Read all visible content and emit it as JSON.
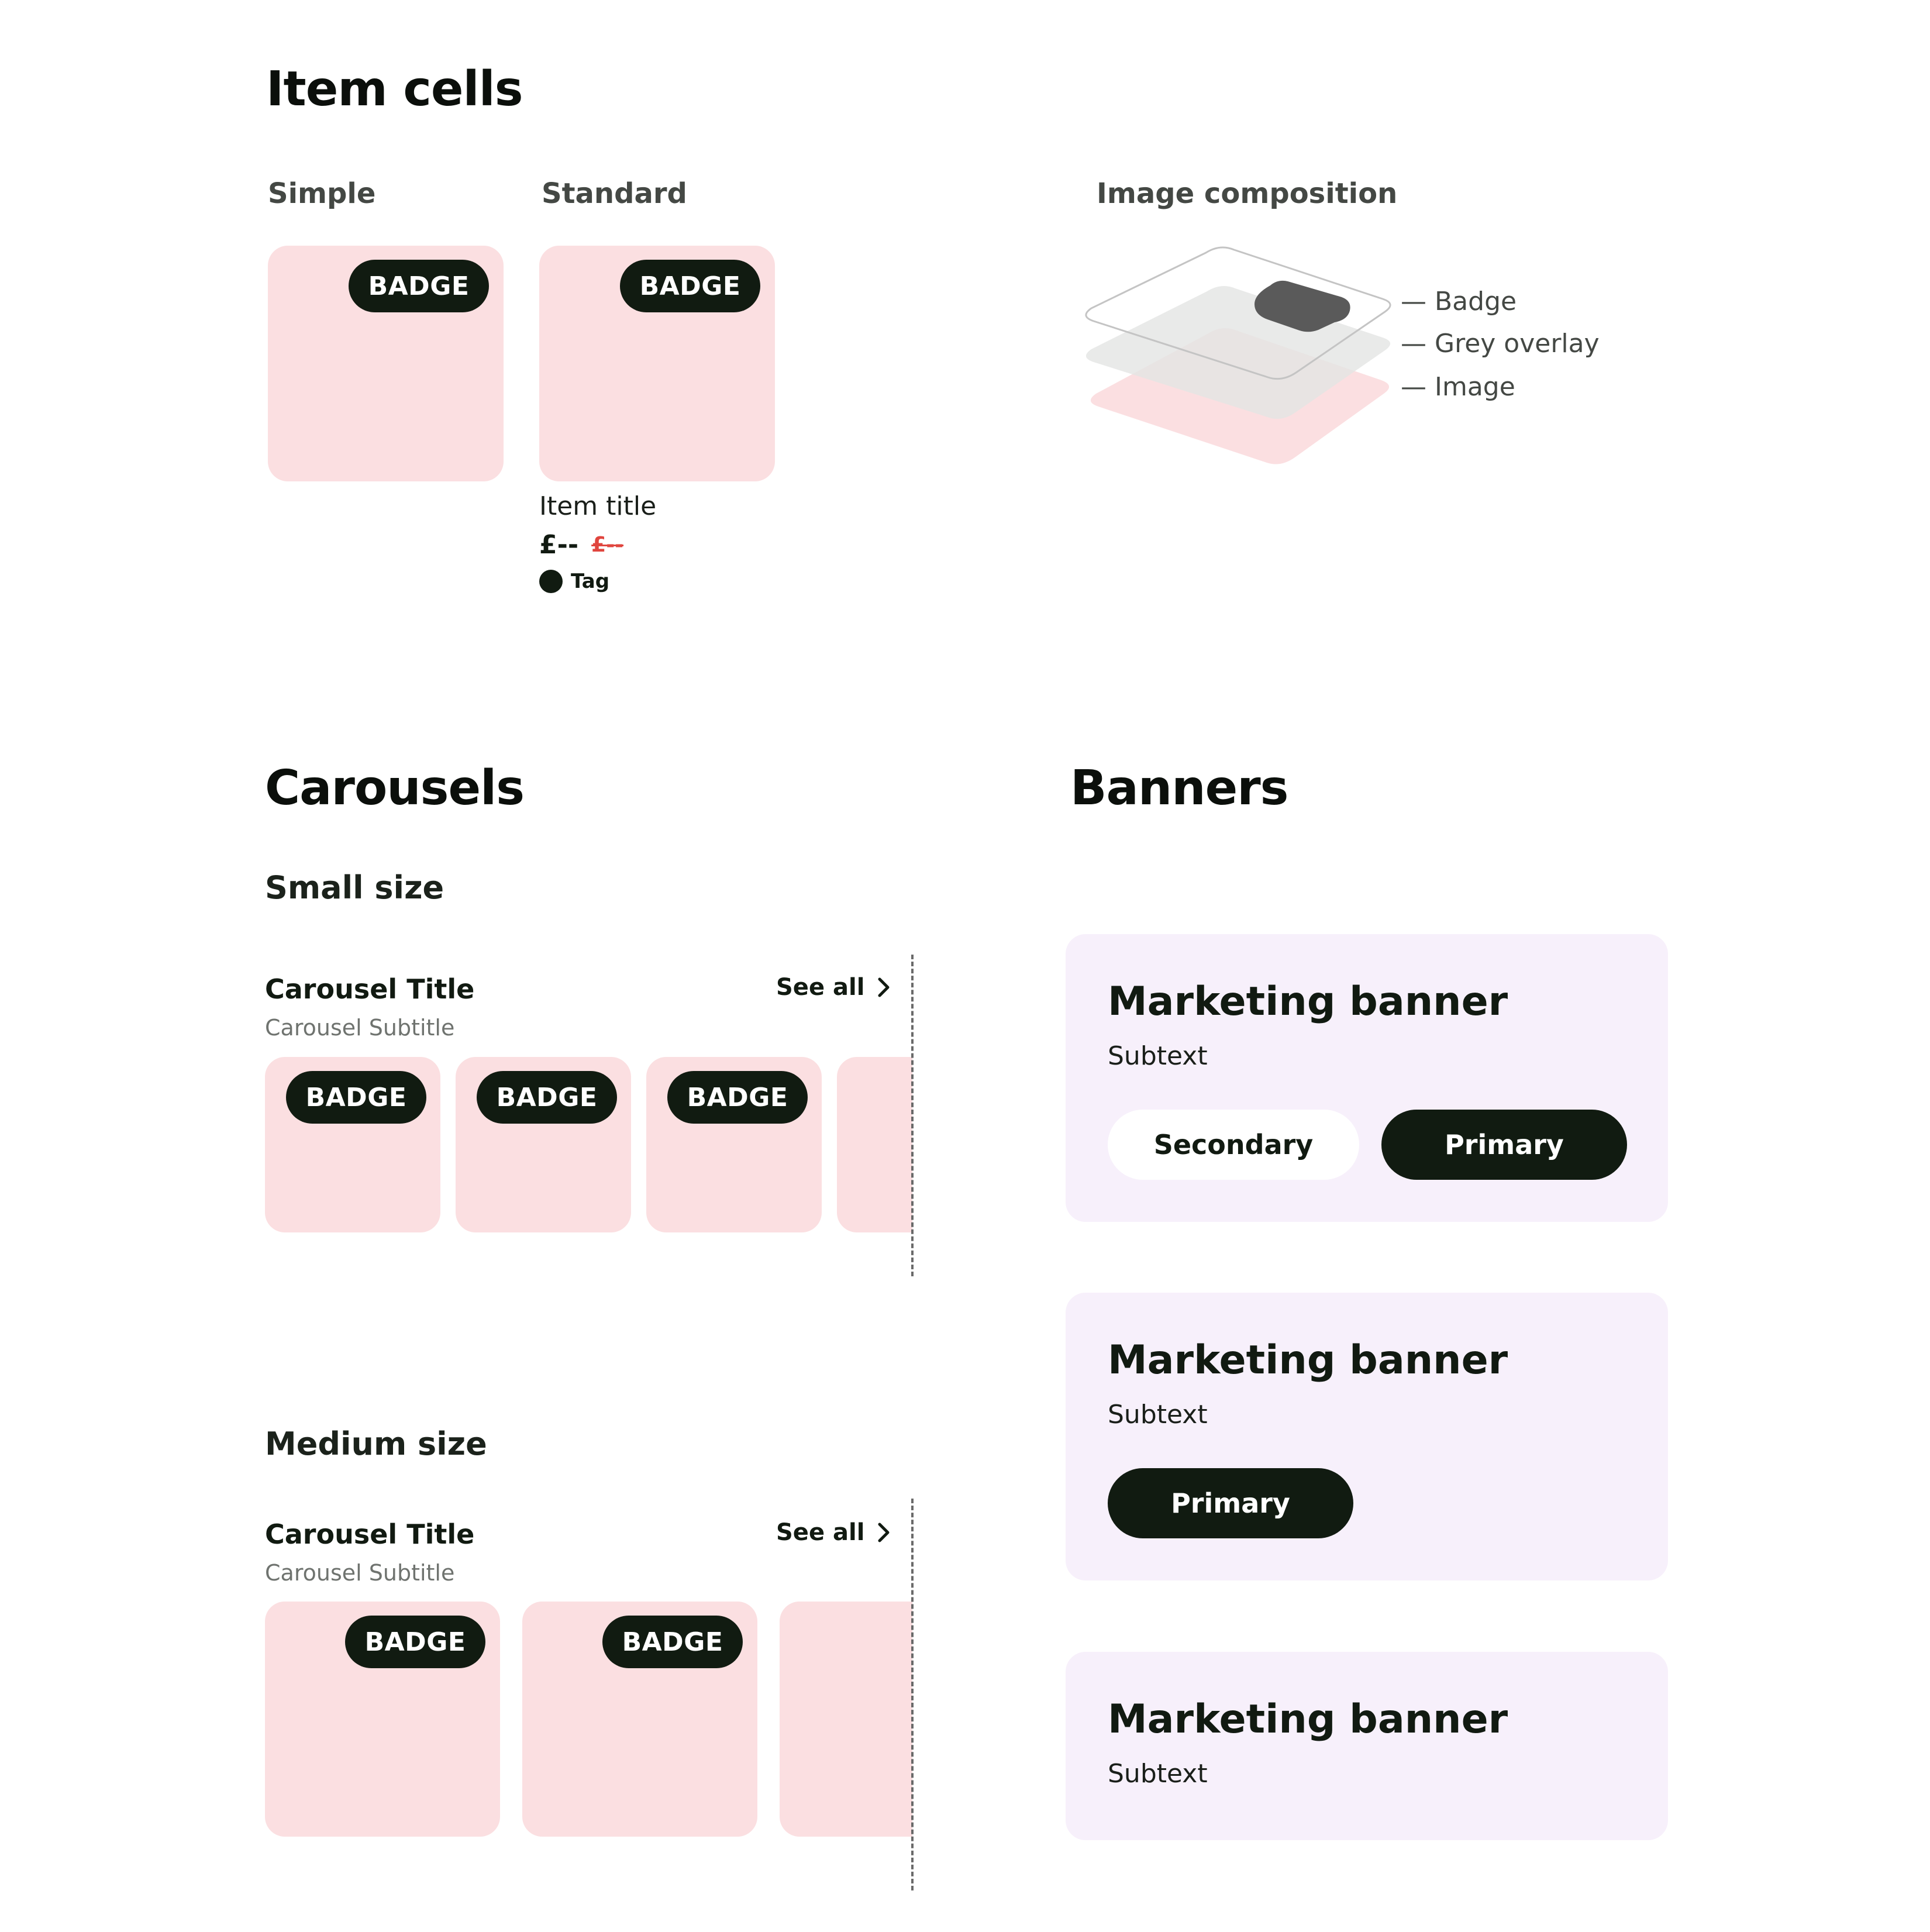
{
  "item_cells": {
    "heading": "Item cells",
    "simple": {
      "label": "Simple",
      "badge": "BADGE"
    },
    "standard": {
      "label": "Standard",
      "badge": "BADGE",
      "item_title": "Item title",
      "price": "£--",
      "price_old": "£--",
      "tag": "Tag"
    },
    "image_composition": {
      "label": "Image composition",
      "layers": [
        "— Badge",
        "— Grey overlay",
        "— Image"
      ]
    }
  },
  "carousels": {
    "heading": "Carousels",
    "small": {
      "label": "Small size",
      "title": "Carousel Title",
      "subtitle": "Carousel Subtitle",
      "see_all": "See all",
      "badges": [
        "BADGE",
        "BADGE",
        "BADGE"
      ]
    },
    "medium": {
      "label": "Medium size",
      "title": "Carousel Title",
      "subtitle": "Carousel Subtitle",
      "see_all": "See all",
      "badges": [
        "BADGE",
        "BADGE"
      ]
    }
  },
  "banners": {
    "heading": "Banners",
    "items": [
      {
        "title": "Marketing banner",
        "subtext": "Subtext",
        "secondary": "Secondary",
        "primary": "Primary"
      },
      {
        "title": "Marketing banner",
        "subtext": "Subtext",
        "primary": "Primary"
      },
      {
        "title": "Marketing banner",
        "subtext": "Subtext"
      }
    ]
  },
  "colors": {
    "tile": "#fbdfe1",
    "badge": "#111b11",
    "banner": "#f7f0fb",
    "price_old": "#e0453e",
    "grey_overlay": "#e3e5e3"
  },
  "icons": [
    "chevron-right-icon",
    "tag-dot-icon"
  ]
}
